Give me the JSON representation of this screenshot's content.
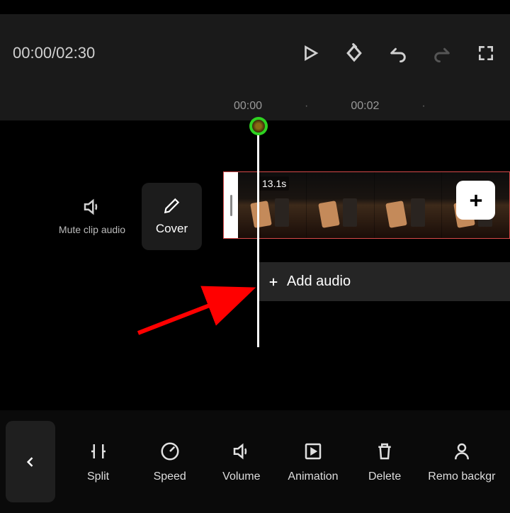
{
  "header": {
    "timecode": "00:00/02:30"
  },
  "ruler": {
    "t0": "00:00",
    "t1": "00:02"
  },
  "timeline": {
    "mute_label": "Mute clip audio",
    "cover_label": "Cover",
    "clip_duration": "13.1s",
    "add_audio_label": "Add audio"
  },
  "tools": {
    "split": "Split",
    "speed": "Speed",
    "volume": "Volume",
    "animation": "Animation",
    "delete": "Delete",
    "remove_bg": "Remo backgr"
  }
}
